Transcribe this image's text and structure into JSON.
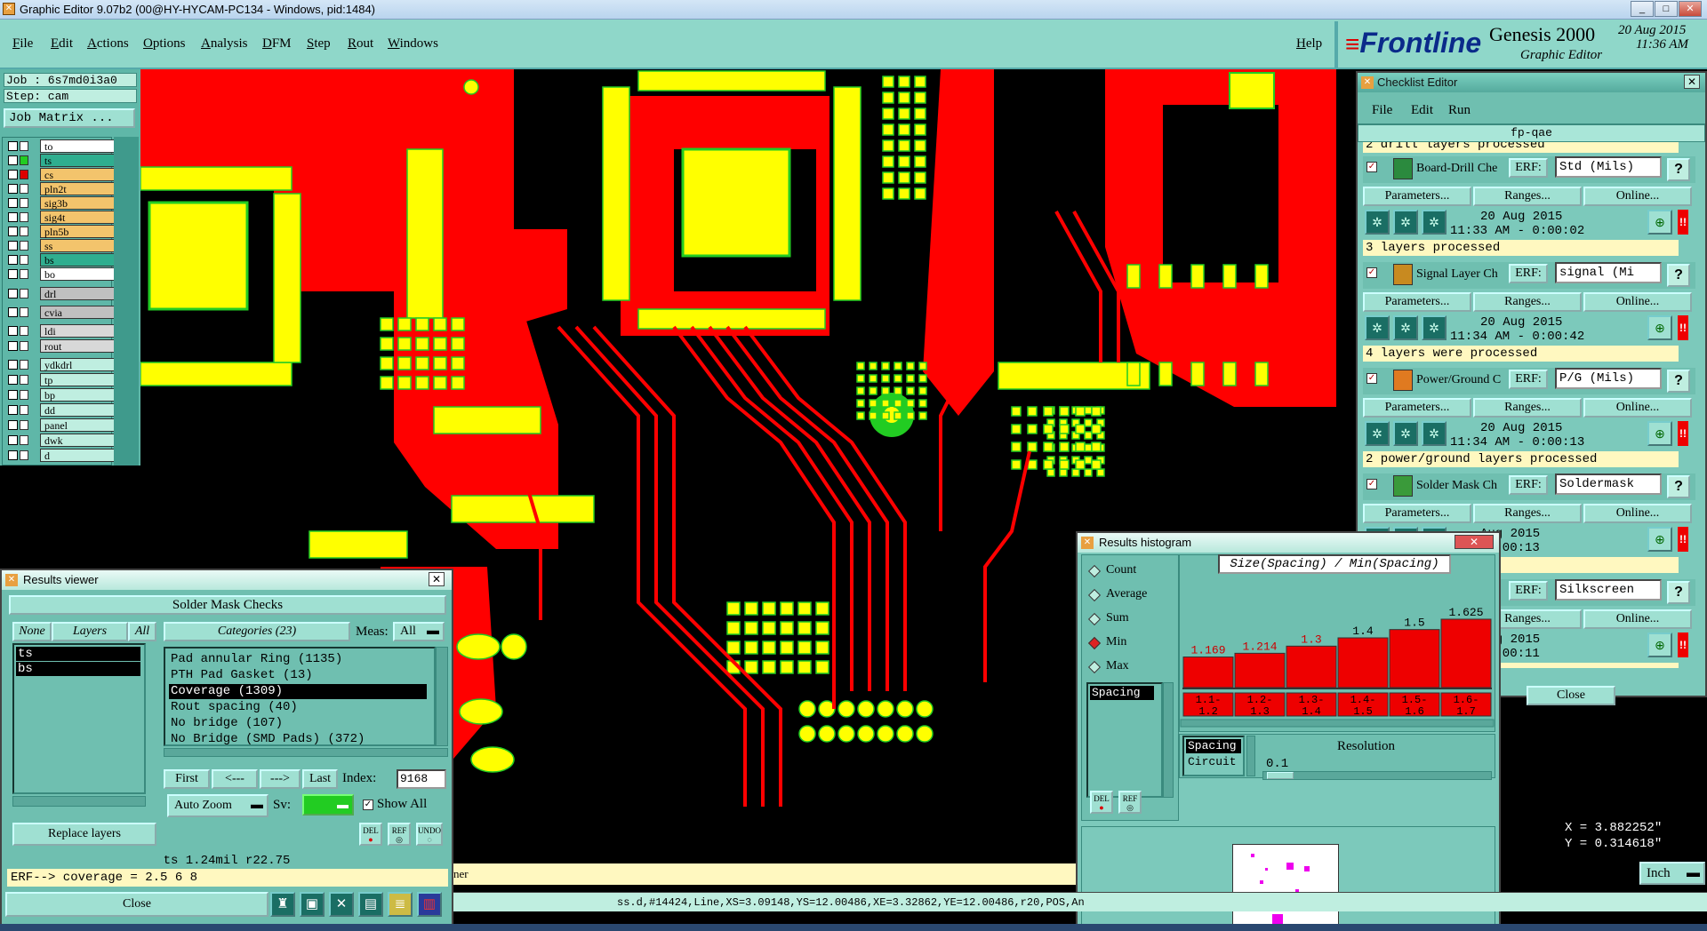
{
  "window": {
    "title": "Graphic Editor 9.07b2 (00@HY-HYCAM-PC134 - Windows, pid:1484)"
  },
  "menu": {
    "items": [
      "File",
      "Edit",
      "Actions",
      "Options",
      "Analysis",
      "DFM",
      "Step",
      "Rout",
      "Windows"
    ],
    "help": "Help"
  },
  "brand": {
    "logo": "Frontline",
    "product": "Genesis 2000",
    "subtitle": "Graphic Editor",
    "date": "20 Aug 2015",
    "time": "11:36 AM"
  },
  "job": {
    "job_line": "Job : 6s7md0i3a0",
    "step_line": "Step: cam",
    "job_matrix": "Job Matrix ..."
  },
  "layers": [
    {
      "name": "to",
      "color": "#ffffff",
      "swatch": "#ffffff"
    },
    {
      "name": "ts",
      "color": "#2fae8f",
      "swatch": "#22cc22"
    },
    {
      "name": "cs",
      "color": "#f3c46c",
      "swatch": "#dd0000"
    },
    {
      "name": "pln2t",
      "color": "#f3c46c",
      "swatch": ""
    },
    {
      "name": "sig3b",
      "color": "#f3c46c",
      "swatch": ""
    },
    {
      "name": "sig4t",
      "color": "#f3c46c",
      "swatch": ""
    },
    {
      "name": "pln5b",
      "color": "#f3c46c",
      "swatch": ""
    },
    {
      "name": "ss",
      "color": "#f3c46c",
      "swatch": ""
    },
    {
      "name": "bs",
      "color": "#2fae8f",
      "swatch": ""
    },
    {
      "name": "bo",
      "color": "#ffffff",
      "swatch": ""
    },
    {
      "name": "drl",
      "color": "#c0c0c0",
      "swatch": ""
    },
    {
      "name": "cvia",
      "color": "#c0c0c0",
      "swatch": ""
    },
    {
      "name": "ldi",
      "color": "#d8d8d8",
      "swatch": ""
    },
    {
      "name": "rout",
      "color": "#d8d8d8",
      "swatch": ""
    },
    {
      "name": "ydkdrl",
      "color": "#bfeee0",
      "swatch": ""
    },
    {
      "name": "tp",
      "color": "#bfeee0",
      "swatch": ""
    },
    {
      "name": "bp",
      "color": "#bfeee0",
      "swatch": ""
    },
    {
      "name": "dd",
      "color": "#bfeee0",
      "swatch": ""
    },
    {
      "name": "panel",
      "color": "#bfeee0",
      "swatch": ""
    },
    {
      "name": "dwk",
      "color": "#bfeee0",
      "swatch": ""
    },
    {
      "name": "d",
      "color": "#bfeee0",
      "swatch": ""
    }
  ],
  "checklist": {
    "title": "Checklist Editor",
    "menu": [
      "File",
      "Edit",
      "Run"
    ],
    "name": "fp-qae",
    "top_status": "2 drill layers processed",
    "params_label": "Parameters...",
    "ranges_label": "Ranges...",
    "online_label": "Online...",
    "erf_label": "ERF:",
    "help_label": "?",
    "red_flag": "!!",
    "close_label": "Close",
    "items": [
      {
        "name": "Board-Drill Che",
        "erf": "Std (Mils)",
        "date": "20 Aug 2015",
        "time": "11:33 AM - 0:00:02",
        "status": "3 layers processed"
      },
      {
        "name": "Signal Layer Ch",
        "erf": "signal (Mi",
        "date": "20 Aug 2015",
        "time": "11:34 AM - 0:00:42",
        "status": "4 layers were processed"
      },
      {
        "name": "Power/Ground C",
        "erf": "P/G (Mils)",
        "date": "20 Aug 2015",
        "time": "11:34 AM - 0:00:13",
        "status": "2 power/ground layers processed"
      },
      {
        "name": "Solder Mask Ch",
        "erf": "Soldermask",
        "date": "Aug 2015",
        "time": "AM - 0:00:13",
        "status": "ers were processed"
      },
      {
        "name": "",
        "erf": "Silkscreen",
        "date": "Aug 2015",
        "time": "AM - 0:00:11",
        "status": "ers processed"
      }
    ],
    "partial_ranges": "anges..."
  },
  "results_viewer": {
    "title": "Results viewer",
    "header": "Solder Mask Checks",
    "none_label": "None",
    "layers_label": "Layers",
    "all_label": "All",
    "categories_label": "Categories (23)",
    "meas_label": "Meas:",
    "meas_value": "All",
    "layer_list": [
      "ts",
      "bs"
    ],
    "categories": [
      "Pad annular Ring (1135)",
      "PTH Pad Gasket (13)",
      "Coverage (1309)",
      "Rout spacing (40)",
      "No bridge (107)",
      "No Bridge (SMD Pads) (372)"
    ],
    "selected_index": 2,
    "first": "First",
    "prev": "<---",
    "next": "--->",
    "last": "Last",
    "index_label": "Index:",
    "index_value": "9168",
    "auto_zoom": "Auto Zoom",
    "sv_label": "Sv:",
    "show_all": "Show All",
    "replace_layers": "Replace layers",
    "del": "DEL",
    "ref": "REF",
    "undo": "UNDO",
    "measure_line": "ts 1.24mil  r22.75",
    "erf_line": "ERF--> coverage = 2.5 6 8",
    "close": "Close"
  },
  "histogram": {
    "title": "Results histogram",
    "options": [
      "Count",
      "Average",
      "Sum",
      "Min",
      "Max"
    ],
    "selected_option": "Min",
    "field_list": [
      "Spacing"
    ],
    "chart_title": "Size(Spacing) / Min(Spacing)",
    "del": "DEL",
    "ref": "REF",
    "type_list": [
      "Spacing",
      "Circuit"
    ],
    "resolution_label": "Resolution",
    "resolution_value": "0.1"
  },
  "chart_data": {
    "type": "bar",
    "title": "Size(Spacing) / Min(Spacing)",
    "categories": [
      "1.1-1.2",
      "1.2-1.3",
      "1.3-1.4",
      "1.4-1.5",
      "1.5-1.6",
      "1.6-1.7"
    ],
    "value_labels": [
      "1.169",
      "1.214",
      "1.3",
      "1.4",
      "1.5",
      "1.625"
    ],
    "values": [
      1.169,
      1.214,
      1.3,
      1.4,
      1.5,
      1.625
    ],
    "ylim": [
      0,
      1.7
    ],
    "bar_color": "#ee0000"
  },
  "status": {
    "left_text": "ner",
    "line": "ss.d,#14424,Line,XS=3.09148,YS=12.00486,XE=3.32862,YE=12.00486,r20,POS,An",
    "x": "X = 3.882252\"",
    "y": "Y = 0.314618\"",
    "units": "Inch"
  },
  "colors": {
    "copper": "#ff0000",
    "pad": "#ffff00",
    "pad_outline": "#22cc22",
    "panel": "#7cc9bb"
  }
}
